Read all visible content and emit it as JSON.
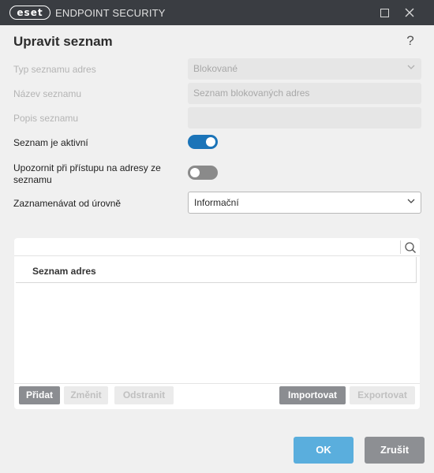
{
  "window": {
    "logo_text": "eset",
    "product_name": "ENDPOINT SECURITY",
    "maximize_icon": "maximize-icon",
    "close_icon": "close-icon"
  },
  "dialog": {
    "title": "Upravit seznam",
    "help_label": "?"
  },
  "form": {
    "list_type": {
      "label": "Typ seznamu adres",
      "value": "Blokované"
    },
    "list_name": {
      "label": "Název seznamu",
      "value": "Seznam blokovaných adres"
    },
    "list_description": {
      "label": "Popis seznamu",
      "value": ""
    },
    "list_active": {
      "label": "Seznam je aktivní",
      "state": "on"
    },
    "notify_on_access": {
      "label": "Upozornit při přístupu na adresy ze seznamu",
      "state": "off"
    },
    "log_level": {
      "label": "Zaznamenávat od úrovně",
      "value": "Informační"
    }
  },
  "list": {
    "search_placeholder": "",
    "column_header": "Seznam adres",
    "rows": []
  },
  "list_toolbar": {
    "add": "Přidat",
    "edit": "Změnit",
    "remove": "Odstranit",
    "import": "Importovat",
    "export": "Exportovat"
  },
  "footer": {
    "ok": "OK",
    "cancel": "Zrušit"
  },
  "colors": {
    "toggle_on": "#1b74b8",
    "ok_button": "#5aaedd",
    "titlebar": "#3a3d42"
  }
}
